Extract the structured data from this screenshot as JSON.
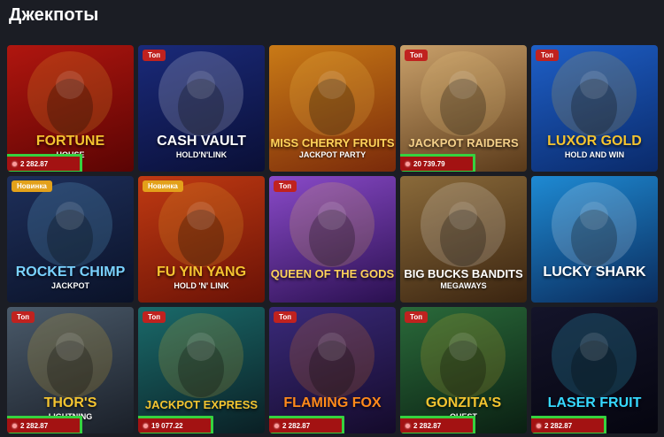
{
  "page": {
    "title": "Джекпоты"
  },
  "badges": {
    "top": "Топ",
    "new": "Новинка"
  },
  "games": [
    {
      "name": "FORTUNE",
      "sub": "HOUSE",
      "badge": "",
      "jackpot": "2 282.87",
      "colors": [
        "#b0160f",
        "#5a0403"
      ],
      "accent": "#f4c430"
    },
    {
      "name": "CASH VAULT",
      "sub": "HOLD'N'LINK",
      "badge": "top",
      "jackpot": "",
      "colors": [
        "#1a2a7a",
        "#0a0f36"
      ],
      "accent": "#ffffff"
    },
    {
      "name": "MISS CHERRY FRUITS",
      "sub": "JACKPOT PARTY",
      "badge": "",
      "jackpot": "",
      "colors": [
        "#c97a16",
        "#7a2a0a"
      ],
      "accent": "#ffd35a"
    },
    {
      "name": "JACKPOT RAIDERS",
      "sub": "",
      "badge": "top",
      "jackpot": "20 739.79",
      "colors": [
        "#c9a06a",
        "#5a3a1a"
      ],
      "accent": "#f4d08a"
    },
    {
      "name": "LUXOR GOLD",
      "sub": "HOLD AND WIN",
      "badge": "top",
      "jackpot": "",
      "colors": [
        "#1e5fc7",
        "#0a2a6a"
      ],
      "accent": "#f4c430"
    },
    {
      "name": "ROCKET CHIMP",
      "sub": "JACKPOT",
      "badge": "new",
      "jackpot": "",
      "colors": [
        "#1e2f5a",
        "#0a1228"
      ],
      "accent": "#7ad3ff"
    },
    {
      "name": "FU YIN YANG",
      "sub": "HOLD 'N' LINK",
      "badge": "new",
      "jackpot": "",
      "colors": [
        "#c03a12",
        "#6a1206"
      ],
      "accent": "#f4c430"
    },
    {
      "name": "QUEEN OF THE GODS",
      "sub": "",
      "badge": "top",
      "jackpot": "",
      "colors": [
        "#8a4ac9",
        "#2a1050"
      ],
      "accent": "#ffd35a"
    },
    {
      "name": "BIG BUCKS BANDITS",
      "sub": "MEGAWAYS",
      "badge": "",
      "jackpot": "",
      "colors": [
        "#8a6a3a",
        "#3a2410"
      ],
      "accent": "#ffffff"
    },
    {
      "name": "LUCKY SHARK",
      "sub": "",
      "badge": "",
      "jackpot": "",
      "colors": [
        "#1e8ad3",
        "#0a2a5a"
      ],
      "accent": "#ffffff"
    },
    {
      "name": "THOR'S",
      "sub": "LIGHTNING",
      "badge": "top",
      "jackpot": "2 282.87",
      "colors": [
        "#4a5a6a",
        "#1a1f28"
      ],
      "accent": "#f4c430"
    },
    {
      "name": "JACKPOT EXPRESS",
      "sub": "",
      "badge": "top",
      "jackpot": "19 077.22",
      "colors": [
        "#1a6a6a",
        "#0a1f24"
      ],
      "accent": "#f4c430"
    },
    {
      "name": "FLAMING FOX",
      "sub": "",
      "badge": "top",
      "jackpot": "2 282.87",
      "colors": [
        "#3a2a7a",
        "#140a2a"
      ],
      "accent": "#ff8a1a"
    },
    {
      "name": "GONZITA'S",
      "sub": "QUEST",
      "badge": "top",
      "jackpot": "2 282.87",
      "colors": [
        "#2a6a3a",
        "#0a1f12"
      ],
      "accent": "#f4c430"
    },
    {
      "name": "LASER FRUIT",
      "sub": "",
      "badge": "",
      "jackpot": "2 282.87",
      "colors": [
        "#14142a",
        "#05050f"
      ],
      "accent": "#36d9ff"
    }
  ]
}
